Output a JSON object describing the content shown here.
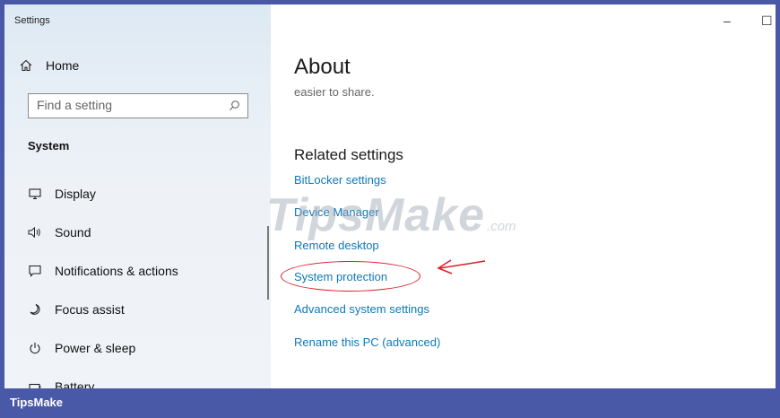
{
  "window": {
    "title": "Settings",
    "minimize_glyph": "–",
    "maximize_glyph": "☐"
  },
  "sidebar": {
    "home": {
      "label": "Home",
      "icon": "home-icon"
    },
    "search": {
      "placeholder": "Find a setting",
      "icon": "search-icon"
    },
    "section_label": "System",
    "items": [
      {
        "label": "Display",
        "icon": "display-icon"
      },
      {
        "label": "Sound",
        "icon": "sound-icon"
      },
      {
        "label": "Notifications & actions",
        "icon": "notifications-icon"
      },
      {
        "label": "Focus assist",
        "icon": "moon-icon"
      },
      {
        "label": "Power & sleep",
        "icon": "power-icon"
      },
      {
        "label": "Battery",
        "icon": "battery-icon"
      }
    ]
  },
  "main": {
    "title": "About",
    "truncated_text": "easier to share.",
    "related_heading": "Related settings",
    "links": [
      "BitLocker settings",
      "Device Manager",
      "Remote desktop",
      "System protection",
      "Advanced system settings",
      "Rename this PC (advanced)"
    ],
    "highlight_color": "#d91f26"
  },
  "watermark": {
    "main": "TipsMake",
    "suffix": ".com"
  },
  "footer": {
    "brand": "TipsMake"
  },
  "colors": {
    "accent_link": "#0f78b8",
    "frame": "#4a58a8",
    "annotation": "#d91f26"
  }
}
